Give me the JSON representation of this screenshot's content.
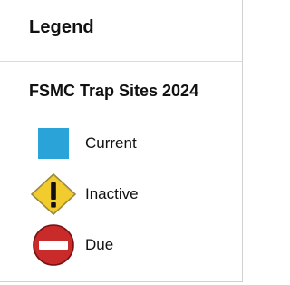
{
  "panel": {
    "title": "Legend"
  },
  "layer": {
    "title": "FSMC Trap Sites 2024",
    "items": [
      {
        "label": "Current",
        "icon": "blue-square-icon",
        "color": "#2aa3d8"
      },
      {
        "label": "Inactive",
        "icon": "warning-diamond-icon",
        "color": "#f2cc2f"
      },
      {
        "label": "Due",
        "icon": "no-entry-icon",
        "color": "#c92a2a"
      }
    ]
  }
}
